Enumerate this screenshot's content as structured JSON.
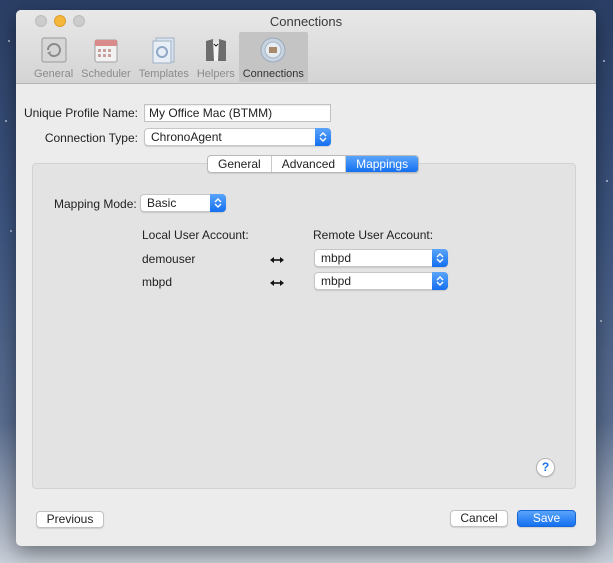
{
  "window": {
    "title": "Connections"
  },
  "toolbar": {
    "items": [
      {
        "label": "General",
        "icon": "general-icon"
      },
      {
        "label": "Scheduler",
        "icon": "calendar-icon"
      },
      {
        "label": "Templates",
        "icon": "templates-icon"
      },
      {
        "label": "Helpers",
        "icon": "tuxedo-icon"
      },
      {
        "label": "Connections",
        "icon": "connections-icon",
        "active": true
      }
    ]
  },
  "form": {
    "profile_name_label": "Unique Profile Name:",
    "profile_name_value": "My Office Mac (BTMM)",
    "connection_type_label": "Connection Type:",
    "connection_type_value": "ChronoAgent"
  },
  "tabs": [
    {
      "label": "General",
      "active": false
    },
    {
      "label": "Advanced",
      "active": false
    },
    {
      "label": "Mappings",
      "active": true
    }
  ],
  "mappings": {
    "mode_label": "Mapping Mode:",
    "mode_value": "Basic",
    "local_header": "Local User Account:",
    "remote_header": "Remote User Account:",
    "rows": [
      {
        "local": "demouser",
        "remote": "mbpd"
      },
      {
        "local": "mbpd",
        "remote": "mbpd"
      }
    ]
  },
  "help_label": "?",
  "buttons": {
    "previous": "Previous",
    "cancel": "Cancel",
    "save": "Save"
  },
  "colors": {
    "accent": "#1470f0",
    "window_bg": "#ececec",
    "pane_bg": "#e3e3e3"
  }
}
